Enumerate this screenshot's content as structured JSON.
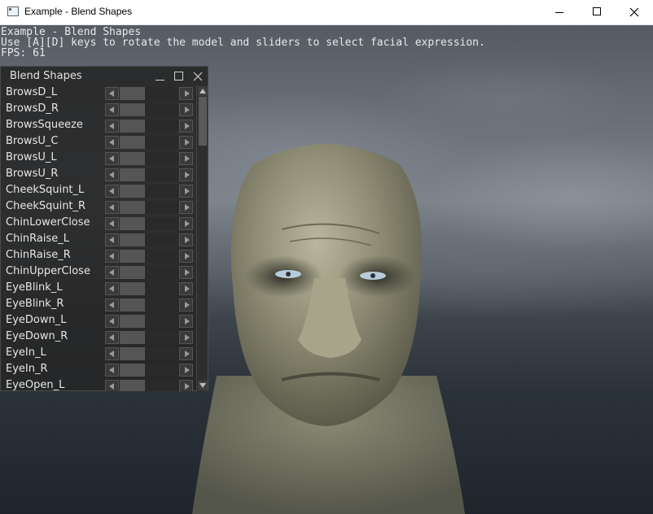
{
  "window": {
    "title": "Example - Blend Shapes"
  },
  "overlay": {
    "line1": "Example - Blend Shapes",
    "line2": "Use [A][D] keys to rotate the model and sliders to select facial expression.",
    "fps": "FPS: 61"
  },
  "panel": {
    "title": "Blend Shapes",
    "rows": [
      {
        "label": "BrowsD_L",
        "value": 0
      },
      {
        "label": "BrowsD_R",
        "value": 0
      },
      {
        "label": "BrowsSqueeze",
        "value": 0
      },
      {
        "label": "BrowsU_C",
        "value": 0
      },
      {
        "label": "BrowsU_L",
        "value": 0
      },
      {
        "label": "BrowsU_R",
        "value": 0
      },
      {
        "label": "CheekSquint_L",
        "value": 0
      },
      {
        "label": "CheekSquint_R",
        "value": 0
      },
      {
        "label": "ChinLowerClose",
        "value": 0
      },
      {
        "label": "ChinRaise_L",
        "value": 0
      },
      {
        "label": "ChinRaise_R",
        "value": 0
      },
      {
        "label": "ChinUpperClose",
        "value": 0
      },
      {
        "label": "EyeBlink_L",
        "value": 0
      },
      {
        "label": "EyeBlink_R",
        "value": 0
      },
      {
        "label": "EyeDown_L",
        "value": 0
      },
      {
        "label": "EyeDown_R",
        "value": 0
      },
      {
        "label": "EyeIn_L",
        "value": 0
      },
      {
        "label": "EyeIn_R",
        "value": 0
      },
      {
        "label": "EyeOpen_L",
        "value": 0
      }
    ]
  },
  "colors": {
    "panel_bg": "#262626",
    "slider_thumb": "#555555",
    "overlay_text": "#e8e8e8"
  }
}
